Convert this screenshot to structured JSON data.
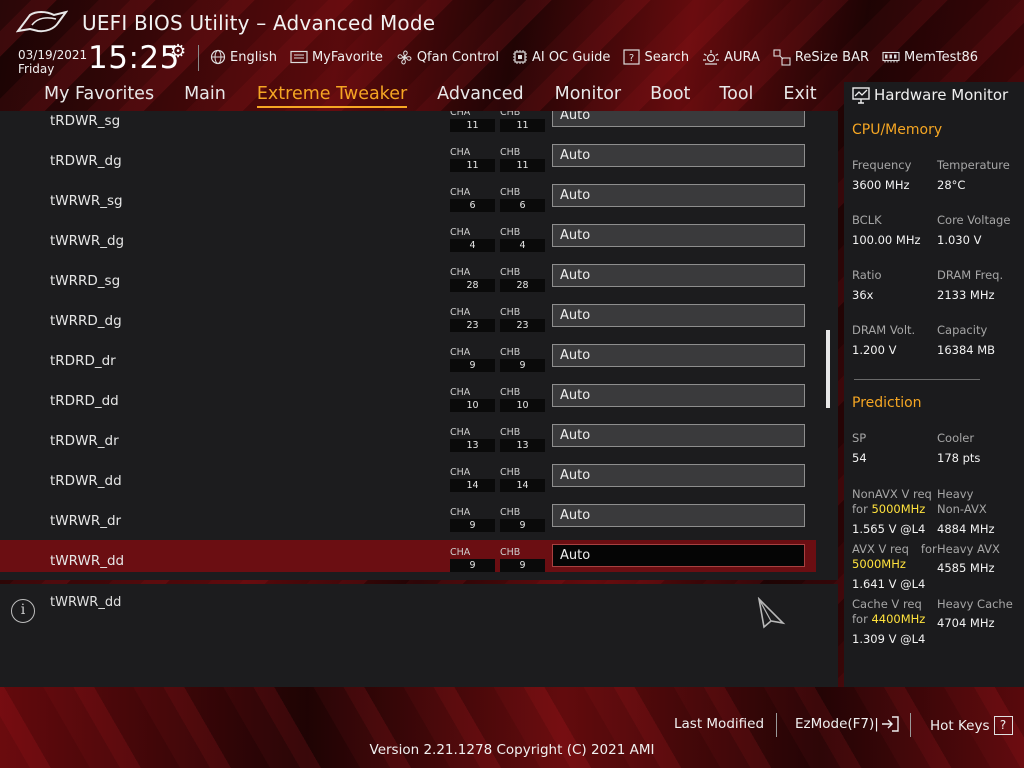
{
  "header": {
    "title": "UEFI BIOS Utility – Advanced Mode",
    "date": "03/19/2021",
    "day": "Friday",
    "time": "15:25",
    "toolbar": [
      {
        "label": "English",
        "icon": "globe-icon"
      },
      {
        "label": "MyFavorite",
        "icon": "favorite-icon"
      },
      {
        "label": "Qfan Control",
        "icon": "fan-icon"
      },
      {
        "label": "AI OC Guide",
        "icon": "ai-chip-icon"
      },
      {
        "label": "Search",
        "icon": "help-search-icon"
      },
      {
        "label": "AURA",
        "icon": "aura-icon"
      },
      {
        "label": "ReSize BAR",
        "icon": "resize-bar-icon"
      },
      {
        "label": "MemTest86",
        "icon": "memtest-icon"
      }
    ]
  },
  "nav": {
    "tabs": [
      {
        "label": "My Favorites"
      },
      {
        "label": "Main"
      },
      {
        "label": "Extreme Tweaker",
        "active": true
      },
      {
        "label": "Advanced"
      },
      {
        "label": "Monitor"
      },
      {
        "label": "Boot"
      },
      {
        "label": "Tool"
      },
      {
        "label": "Exit"
      }
    ]
  },
  "list": {
    "channel_a_label": "CHA",
    "channel_b_label": "CHB",
    "rows": [
      {
        "label": "tRDWR_sg",
        "cha": "11",
        "chb": "11",
        "value": "Auto"
      },
      {
        "label": "tRDWR_dg",
        "cha": "11",
        "chb": "11",
        "value": "Auto"
      },
      {
        "label": "tWRWR_sg",
        "cha": "6",
        "chb": "6",
        "value": "Auto"
      },
      {
        "label": "tWRWR_dg",
        "cha": "4",
        "chb": "4",
        "value": "Auto"
      },
      {
        "label": "tWRRD_sg",
        "cha": "28",
        "chb": "28",
        "value": "Auto"
      },
      {
        "label": "tWRRD_dg",
        "cha": "23",
        "chb": "23",
        "value": "Auto"
      },
      {
        "label": "tRDRD_dr",
        "cha": "9",
        "chb": "9",
        "value": "Auto"
      },
      {
        "label": "tRDRD_dd",
        "cha": "10",
        "chb": "10",
        "value": "Auto"
      },
      {
        "label": "tRDWR_dr",
        "cha": "13",
        "chb": "13",
        "value": "Auto"
      },
      {
        "label": "tRDWR_dd",
        "cha": "14",
        "chb": "14",
        "value": "Auto"
      },
      {
        "label": "tWRWR_dr",
        "cha": "9",
        "chb": "9",
        "value": "Auto"
      },
      {
        "label": "tWRWR_dd",
        "cha": "9",
        "chb": "9",
        "value": "Auto",
        "selected": true
      }
    ]
  },
  "info": {
    "text": "tWRWR_dd"
  },
  "hardware_monitor": {
    "title": "Hardware Monitor",
    "cpu_memory": {
      "heading": "CPU/Memory",
      "frequency_label": "Frequency",
      "frequency": "3600 MHz",
      "temperature_label": "Temperature",
      "temperature": "28°C",
      "bclk_label": "BCLK",
      "bclk": "100.00 MHz",
      "core_voltage_label": "Core Voltage",
      "core_voltage": "1.030 V",
      "ratio_label": "Ratio",
      "ratio": "36x",
      "dram_freq_label": "DRAM Freq.",
      "dram_freq": "2133 MHz",
      "dram_volt_label": "DRAM Volt.",
      "dram_volt": "1.200 V",
      "capacity_label": "Capacity",
      "capacity": "16384 MB"
    },
    "prediction": {
      "heading": "Prediction",
      "sp_label": "SP",
      "sp": "54",
      "cooler_label": "Cooler",
      "cooler": "178 pts",
      "nonavx_label_1": "NonAVX V req",
      "nonavx_for": "for",
      "nonavx_freq": "5000MHz",
      "nonavx_value": "1.565 V @L4",
      "heavy_nonavx_label_1": "Heavy",
      "heavy_nonavx_label_2": "Non-AVX",
      "heavy_nonavx_value": "4884 MHz",
      "avx_label_1": "AVX V req",
      "avx_for": "for",
      "avx_freq": "5000MHz",
      "avx_value": "1.641 V @L4",
      "heavy_avx_label": "Heavy AVX",
      "heavy_avx_value": "4585 MHz",
      "cache_label_1": "Cache V req",
      "cache_for": "for",
      "cache_freq": "4400MHz",
      "cache_value": "1.309 V @L4",
      "heavy_cache_label": "Heavy Cache",
      "heavy_cache_value": "4704 MHz"
    }
  },
  "footer": {
    "last_modified": "Last Modified",
    "ezmode": "EzMode(F7)|",
    "hot_keys": "Hot Keys",
    "hot_keys_glyph": "?",
    "version": "Version 2.21.1278 Copyright (C) 2021 AMI"
  },
  "colors": {
    "accent": "#f5a623",
    "highlight": "#ffe23d",
    "selected_row": "#6b0e12",
    "panel": "#1c1c1e"
  }
}
